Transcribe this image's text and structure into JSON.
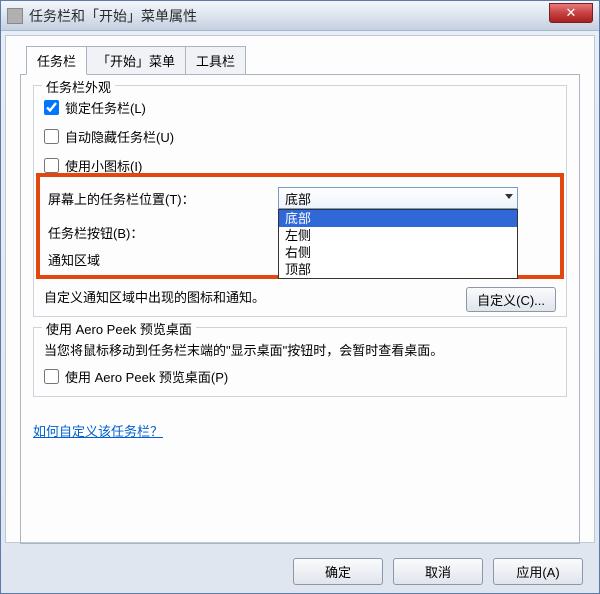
{
  "window": {
    "title": "任务栏和「开始」菜单属性",
    "close_glyph": "✕"
  },
  "tabs": {
    "taskbar": "任务栏",
    "start_menu": "「开始」菜单",
    "toolbars": "工具栏"
  },
  "appearance": {
    "group_title": "任务栏外观",
    "lock_taskbar": "锁定任务栏(L)",
    "autohide": "自动隐藏任务栏(U)",
    "small_icons": "使用小图标(I)",
    "location_label": "屏幕上的任务栏位置(T)：",
    "buttons_label": "任务栏按钮(B)：",
    "location_selected": "底部",
    "location_options": [
      "底部",
      "左侧",
      "右侧",
      "顶部"
    ]
  },
  "notify": {
    "group_title": "通知区域",
    "desc": "自定义通知区域中出现的图标和通知。",
    "custom_btn": "自定义(C)..."
  },
  "aero": {
    "group_title": "使用 Aero Peek 预览桌面",
    "desc": "当您将鼠标移动到任务栏末端的\"显示桌面\"按钮时，会暂时查看桌面。",
    "checkbox": "使用 Aero Peek 预览桌面(P)"
  },
  "help_link": "如何自定义该任务栏？",
  "buttons": {
    "ok": "确定",
    "cancel": "取消",
    "apply": "应用(A)"
  }
}
